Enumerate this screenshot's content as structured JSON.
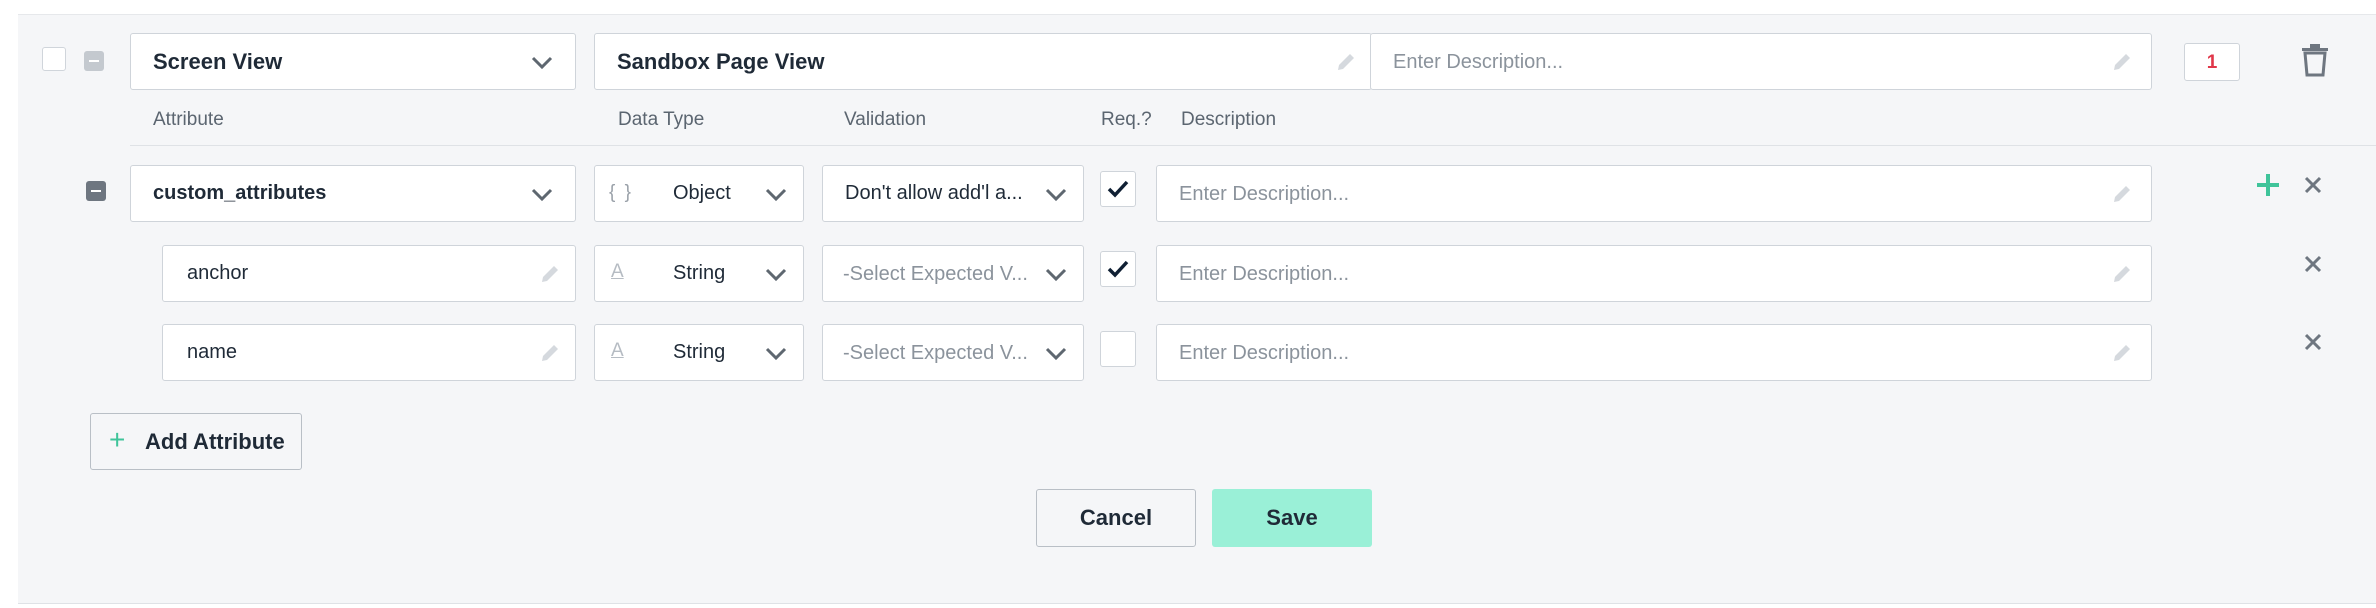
{
  "event": {
    "type_value": "Screen View",
    "name_value": "Sandbox Page View",
    "description_placeholder": "Enter Description...",
    "count_badge": "1"
  },
  "columns": {
    "attribute": "Attribute",
    "data_type": "Data Type",
    "validation": "Validation",
    "required": "Req.?",
    "description": "Description"
  },
  "attributes": [
    {
      "name": "custom_attributes",
      "type_icon": "{ }",
      "data_type": "Object",
      "validation": "Don't allow add'l a...",
      "required": true,
      "description_placeholder": "Enter Description..."
    },
    {
      "name": "anchor",
      "type_icon": "A",
      "data_type": "String",
      "validation": "-Select Expected V...",
      "required": true,
      "description_placeholder": "Enter Description..."
    },
    {
      "name": "name",
      "type_icon": "A",
      "data_type": "String",
      "validation": "-Select Expected V...",
      "required": false,
      "description_placeholder": "Enter Description..."
    }
  ],
  "buttons": {
    "add_attribute": "Add Attribute",
    "add_attribute_icon": "+",
    "cancel": "Cancel",
    "save": "Save"
  },
  "colors": {
    "accent_green": "#3fc49a",
    "save_bg": "#9af0d7",
    "badge_red": "#e0374a",
    "check_dark": "#0f1f33"
  }
}
